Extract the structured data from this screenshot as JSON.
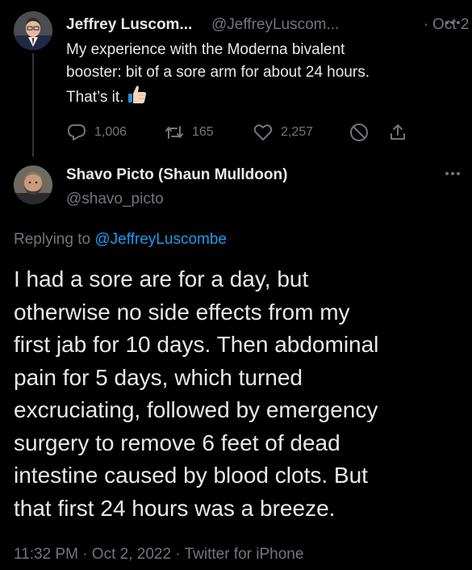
{
  "parent_tweet": {
    "display_name": "Jeffrey Luscom...",
    "handle": "@JeffreyLuscom...",
    "separator": "·",
    "date": "Oct 2",
    "body_lines": [
      "My experience with the Moderna bivalent",
      "booster: bit of a sore arm for about 24 hours.",
      "That’s it."
    ],
    "emoji": "thumbs-up",
    "stats": {
      "replies": "1,006",
      "retweets": "165",
      "likes": "2,257"
    }
  },
  "reply_tweet": {
    "display_name": "Shavo Picto (Shaun Mulldoon)",
    "handle": "@shavo_picto",
    "replying_prefix": "Replying to ",
    "replying_to": "@JeffreyLuscombe",
    "body_lines": [
      "I had a sore are for a day, but",
      "otherwise no side effects from my",
      "first jab for 10 days. Then abdominal",
      "pain for 5 days, which turned",
      "excruciating, followed by emergency",
      "surgery to remove 6 feet of dead",
      "intestine caused by blood clots. But",
      "that first 24 hours was a breeze."
    ],
    "meta": "11:32 PM · Oct 2, 2022 · Twitter for iPhone"
  },
  "colors": {
    "background": "#000000",
    "primary_text": "#e7e9ea",
    "secondary_text": "#71767b",
    "link": "#1d9bf0",
    "thread_line": "#333639"
  }
}
